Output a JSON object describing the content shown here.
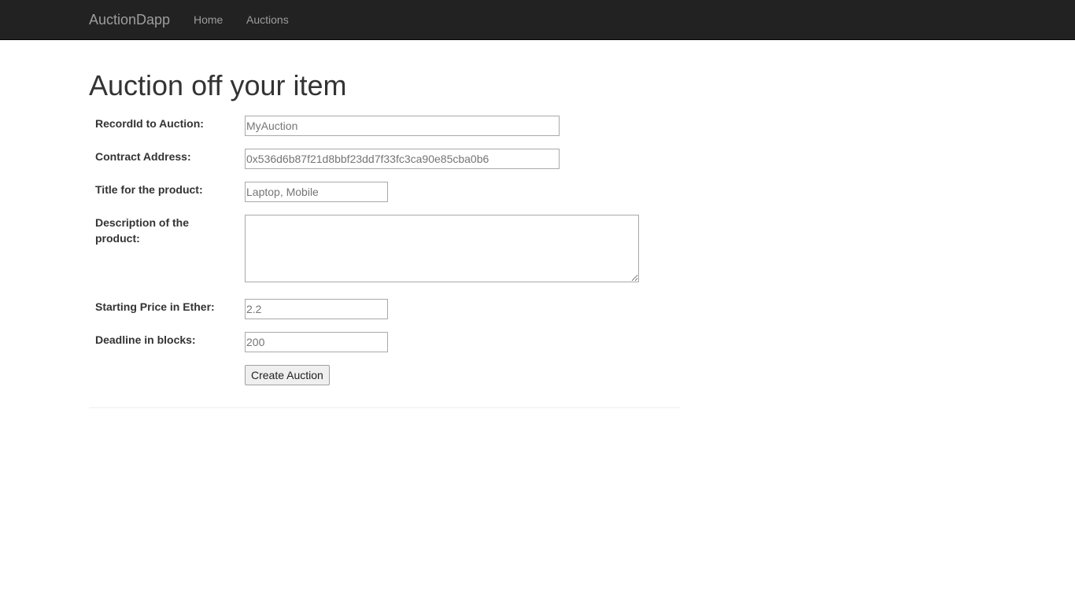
{
  "navbar": {
    "brand": "AuctionDapp",
    "links": [
      "Home",
      "Auctions"
    ]
  },
  "page": {
    "title": "Auction off your item"
  },
  "form": {
    "record_id": {
      "label": "RecordId to Auction:",
      "placeholder": "MyAuction",
      "value": ""
    },
    "contract_address": {
      "label": "Contract Address:",
      "placeholder": "0x536d6b87f21d8bbf23dd7f33fc3ca90e85cba0b6",
      "value": ""
    },
    "title": {
      "label": "Title for the product:",
      "placeholder": "Laptop, Mobile",
      "value": ""
    },
    "description": {
      "label": "Description of the product:",
      "value": ""
    },
    "starting_price": {
      "label": "Starting Price in Ether:",
      "placeholder": "2.2",
      "value": ""
    },
    "deadline": {
      "label": "Deadline in blocks:",
      "placeholder": "200",
      "value": ""
    },
    "submit_label": "Create Auction"
  },
  "colors": {
    "navbar_bg": "#222222",
    "nav_text": "#9d9d9d",
    "text": "#333333"
  }
}
